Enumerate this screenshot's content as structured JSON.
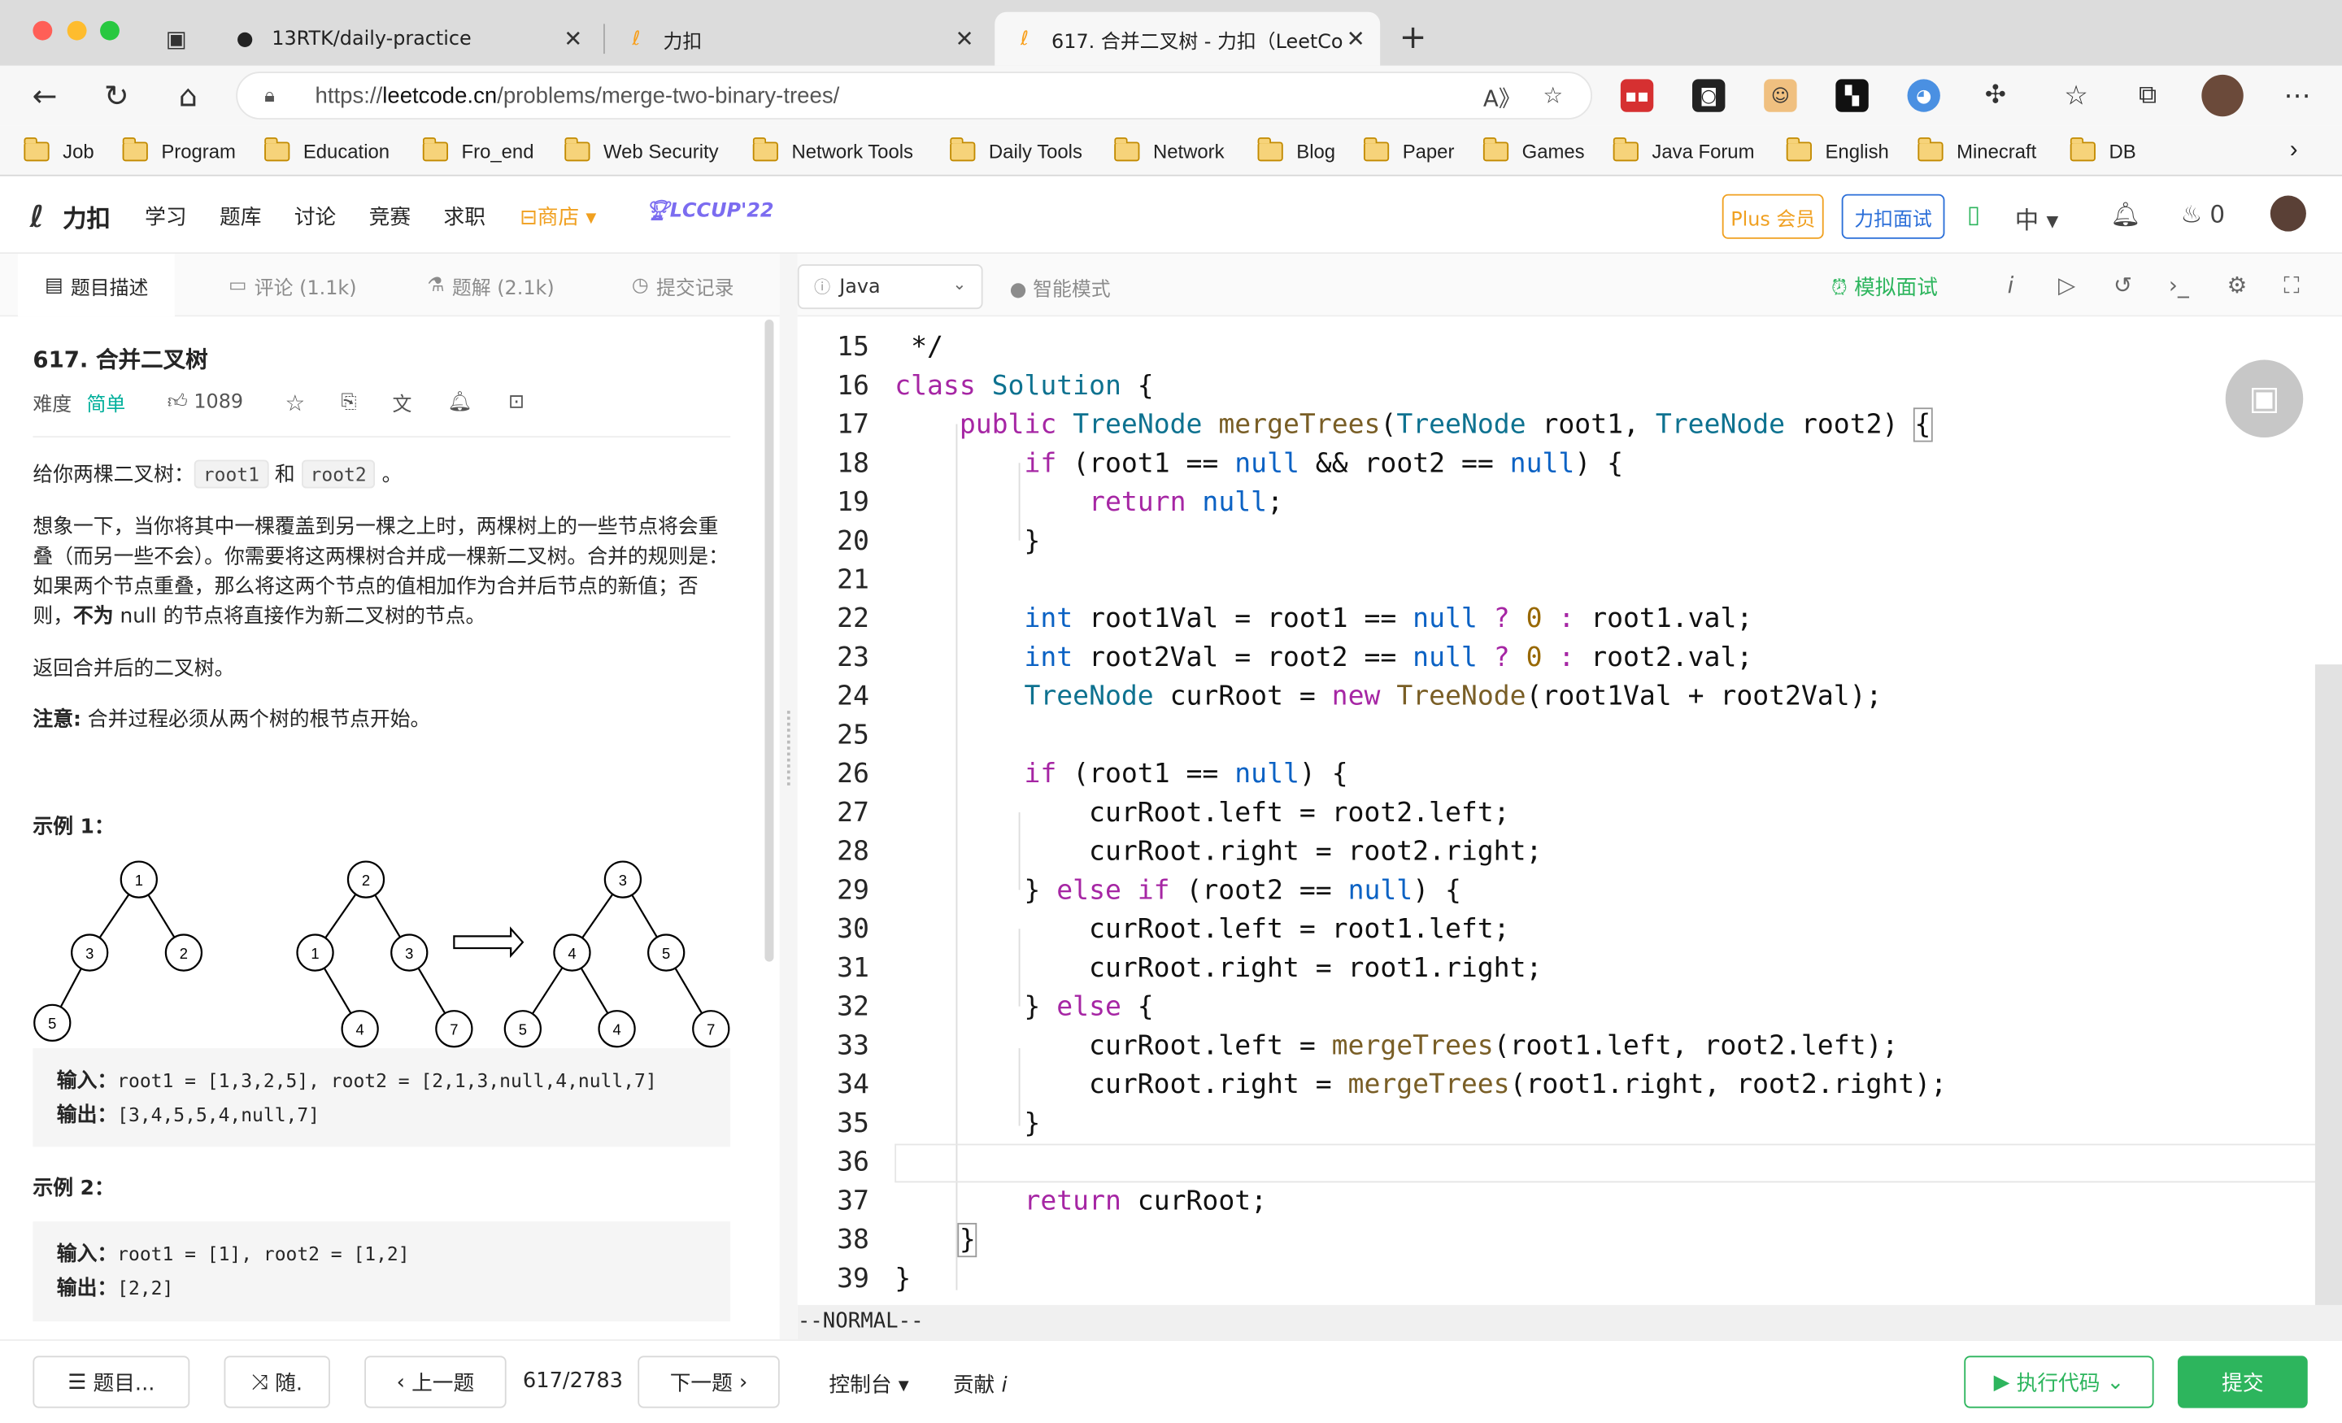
{
  "browser": {
    "tabs": [
      {
        "title": "13RTK/daily-practice",
        "icon": "github-icon"
      },
      {
        "title": "力扣",
        "icon": "leetcode-icon"
      },
      {
        "title": "617. 合并二叉树 - 力扣（LeetCo",
        "icon": "leetcode-icon"
      }
    ],
    "url_prefix": "https://",
    "url_host": "leetcode.cn",
    "url_path": "/problems/merge-two-binary-trees/",
    "bookmarks": [
      "Job",
      "Program",
      "Education",
      "Fro_end",
      "Web Security",
      "Network Tools",
      "Daily Tools",
      "Network",
      "Blog",
      "Paper",
      "Games",
      "Java Forum",
      "English",
      "Minecraft",
      "DB"
    ]
  },
  "header": {
    "logo": "力扣",
    "nav": [
      "学习",
      "题库",
      "讨论",
      "竞赛",
      "求职"
    ],
    "shop": "商店",
    "event": "LCCUP'22",
    "plus": "Plus 会员",
    "interview": "力扣面试",
    "lang": "中",
    "points": "0"
  },
  "left": {
    "tabs": {
      "desc": "题目描述",
      "comments": "评论 (1.1k)",
      "solutions": "题解 (2.1k)",
      "submissions": "提交记录"
    },
    "title": "617. 合并二叉树",
    "difficulty_label": "难度",
    "difficulty": "简单",
    "likes": "1089",
    "p1_pre": "给你两棵二叉树：",
    "p1_code1": "root1",
    "p1_mid": "和",
    "p1_code2": "root2",
    "p1_post": "。",
    "p2_a": "想象一下，当你将其中一棵覆盖到另一棵之上时，两棵树上的一些节点将会重叠（而另一些不会）。你需要将这两棵树合并成一棵新二叉树。合并的规则是：如果两个节点重叠，那么将这两个节点的值相加作为合并后节点的新值；否则，",
    "p2_bold": "不为",
    "p2_b": " null 的节点将直接作为新二叉树的节点。",
    "p3": "返回合并后的二叉树。",
    "p4_bold": "注意:",
    "p4": " 合并过程必须从两个树的根节点开始。",
    "ex1_label": "示例 1：",
    "ex1_in_label": "输入：",
    "ex1_in": "root1 = [1,3,2,5], root2 = [2,1,3,null,4,null,7]",
    "ex1_out_label": "输出：",
    "ex1_out": "[3,4,5,5,4,null,7]",
    "ex2_label": "示例 2：",
    "ex2_in_label": "输入：",
    "ex2_in": "root1 = [1], root2 = [1,2]",
    "ex2_out_label": "输出：",
    "ex2_out": "[2,2]",
    "tree1": [
      "1",
      "3",
      "2",
      "5"
    ],
    "tree2": [
      "2",
      "1",
      "3",
      "4",
      "7"
    ],
    "tree3": [
      "3",
      "4",
      "5",
      "5",
      "4",
      "7"
    ]
  },
  "editor": {
    "language": "Java",
    "smart_mode": "智能模式",
    "mock_interview": "模拟面试",
    "status": "--NORMAL--"
  },
  "bottom": {
    "list": "题目...",
    "random": "随.",
    "prev": "上一题",
    "progress": "617/2783",
    "next": "下一题",
    "console": "控制台",
    "contribute": "贡献",
    "run": "执行代码",
    "submit": "提交"
  }
}
